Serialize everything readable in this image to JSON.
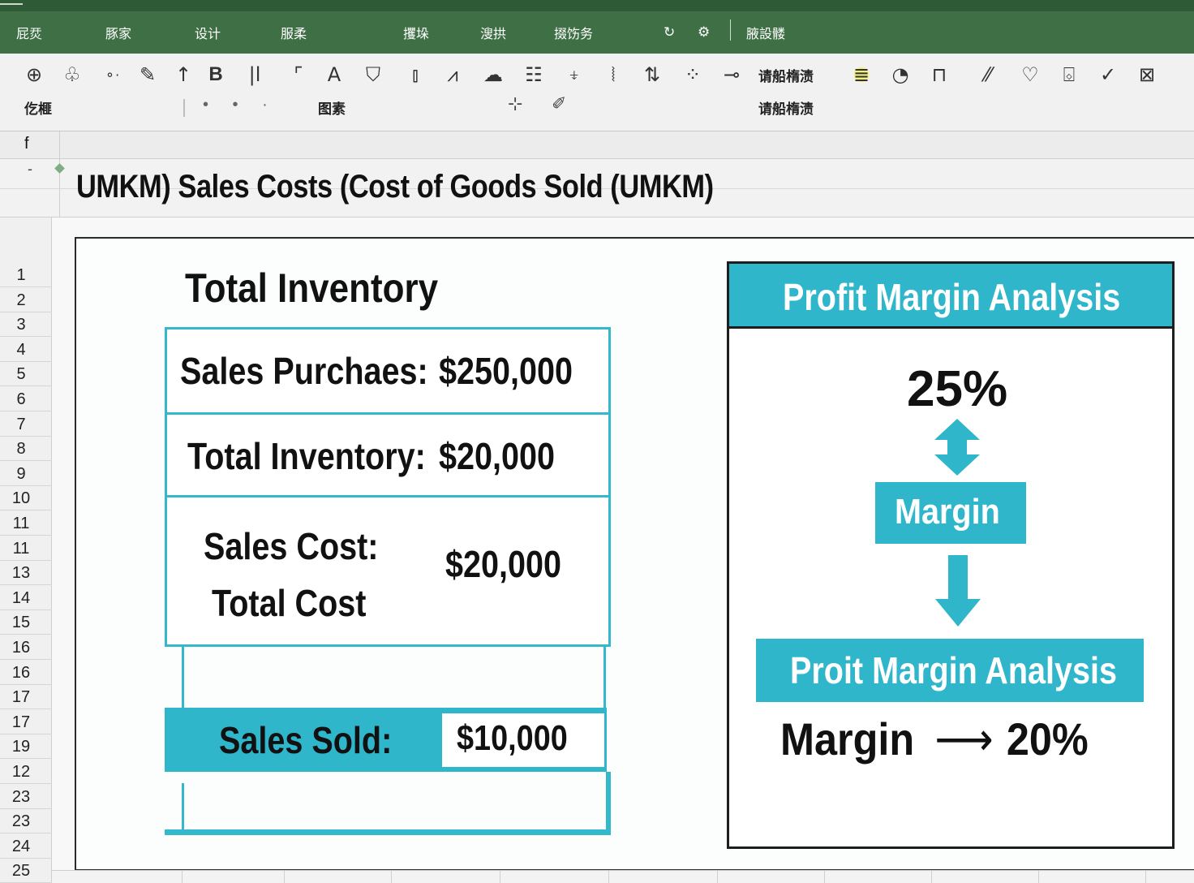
{
  "ribbon": {
    "tabs": [
      "屁烎",
      "豚家",
      "设计",
      "服柔",
      "攫垛",
      "溲拱",
      "掇饬务"
    ],
    "tab_icons": [
      "refresh-icon",
      "settings-icon"
    ],
    "extra_tab": "腋設髅",
    "colors": {
      "ribbon_green": "#3f6f45",
      "ribbon_dark": "#2f5a36"
    }
  },
  "toolbar": {
    "icons": [
      "plus-circle-icon",
      "shapes-icon",
      "link-icon",
      "pencil-icon",
      "arrow-up-icon",
      "bold-icon",
      "line-icon",
      "corner-icon",
      "font-color-icon",
      "fill-icon",
      "column-icon",
      "chart-icon",
      "cloud-icon",
      "list-icon",
      "anchor-icon",
      "curve-icon",
      "sort-icon",
      "connector-icon",
      "minus-icon"
    ],
    "bold_label": "B",
    "font_label": "A",
    "style_label_top": "请船楕渍",
    "style_label_bottom": "请船楕渍",
    "group_label_left": "仡榧",
    "group_label_mid": "图素",
    "right_icons": [
      "highlight-icon",
      "chart-pie-icon",
      "briefcase-icon",
      "slash-icon",
      "shield-icon",
      "comment-icon",
      "check-icon",
      "image-icon"
    ]
  },
  "formula_bar": {
    "name_box": "f",
    "title_row_marker": "-"
  },
  "sheet": {
    "title": "UMKM)  Sales Costs (Cost of Goods Sold (UMKM)",
    "row_numbers": [
      "1",
      "2",
      "3",
      "4",
      "5",
      "6",
      "7",
      "8",
      "9",
      "10",
      "11",
      "11",
      "13",
      "14",
      "15",
      "16",
      "16",
      "17",
      "17",
      "19",
      "12",
      "23",
      "23",
      "24",
      "25"
    ]
  },
  "inventory": {
    "heading": "Total Inventory",
    "rows": [
      {
        "label": "Sales Purchaes:",
        "value": "$250,000"
      },
      {
        "label": "Total Inventory:",
        "value": "$20,000"
      },
      {
        "label_line1": "Sales Cost:",
        "label_line2": "Total Cost",
        "value": "$20,0​00"
      }
    ],
    "sold": {
      "label": "Sales Sold:",
      "value": "$10,000"
    },
    "accent": "#34b8cc"
  },
  "profit_panel": {
    "header": "Profit Margin Analysis",
    "top_percent": "25%",
    "margin_box": "Margin",
    "analysis_bar": "Proit Margin Analysis",
    "result_label": "Margin",
    "result_arrow": "⟶",
    "result_percent": "20%",
    "accent": "#2fb6cb"
  }
}
